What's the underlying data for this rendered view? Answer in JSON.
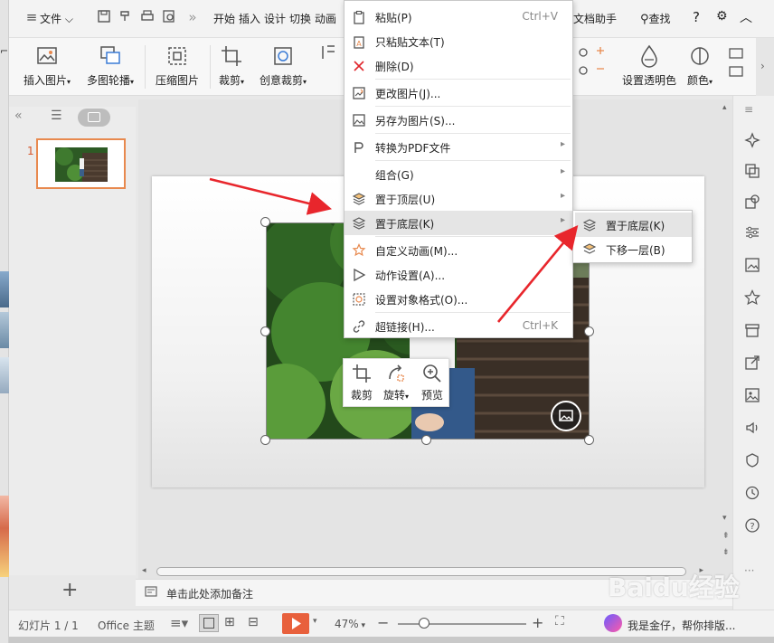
{
  "titlebar": {
    "file_menu": "文件",
    "tabs": [
      "开始",
      "插入",
      "设计",
      "切换",
      "动画"
    ],
    "right_tab": "文档助手",
    "search_label": "查找",
    "help_icon": "?"
  },
  "ribbon": {
    "insert_picture": "插入图片",
    "multi_carousel": "多图轮播",
    "compress_picture": "压缩图片",
    "crop": "裁剪",
    "creative_crop": "创意裁剪",
    "set_transparent": "设置透明色",
    "color": "颜色"
  },
  "thumbnails": {
    "slide_number": "1"
  },
  "context_menu": {
    "items": [
      {
        "label": "粘贴(P)",
        "shortcut": "Ctrl+V",
        "icon": "paste-icon"
      },
      {
        "label": "只粘贴文本(T)",
        "shortcut": "",
        "icon": "paste-text-icon"
      },
      {
        "label": "删除(D)",
        "shortcut": "",
        "icon": "delete-icon"
      },
      {
        "label": "更改图片(J)...",
        "shortcut": "",
        "icon": "change-picture-icon"
      },
      {
        "label": "另存为图片(S)...",
        "shortcut": "",
        "icon": "save-as-picture-icon"
      },
      {
        "label": "转换为PDF文件",
        "shortcut": "",
        "icon": "pdf-icon"
      },
      {
        "label": "组合(G)",
        "shortcut": "",
        "icon": ""
      },
      {
        "label": "置于顶层(U)",
        "shortcut": "",
        "icon": "bring-to-front-icon"
      },
      {
        "label": "置于底层(K)",
        "shortcut": "",
        "icon": "send-to-back-icon"
      },
      {
        "label": "自定义动画(M)...",
        "shortcut": "",
        "icon": "custom-animation-icon"
      },
      {
        "label": "动作设置(A)...",
        "shortcut": "",
        "icon": "action-settings-icon"
      },
      {
        "label": "设置对象格式(O)...",
        "shortcut": "",
        "icon": "format-object-icon"
      },
      {
        "label": "超链接(H)...",
        "shortcut": "Ctrl+K",
        "icon": "hyperlink-icon"
      }
    ]
  },
  "submenu": {
    "items": [
      {
        "label": "置于底层(K)",
        "icon": "send-to-back-icon"
      },
      {
        "label": "下移一层(B)",
        "icon": "send-backward-icon"
      }
    ]
  },
  "mini_toolbar": {
    "crop": "裁剪",
    "rotate": "旋转",
    "preview": "预览"
  },
  "notes": {
    "placeholder": "单击此处添加备注"
  },
  "statusbar": {
    "slide_info": "幻灯片 1 / 1",
    "theme": "Office 主题",
    "zoom": "47%",
    "assistant_text": "我是金仔，帮你排版..."
  },
  "watermark": "Baidu经验",
  "colors": {
    "accent_orange": "#e8894e",
    "play_button": "#e8603c",
    "delete_red": "#e0262c",
    "arrow_red": "#e8262c"
  }
}
